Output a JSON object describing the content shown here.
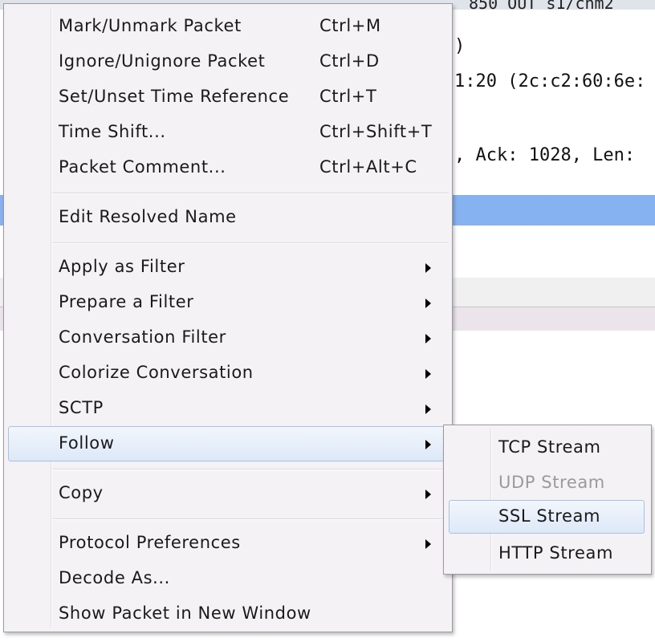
{
  "background": {
    "header_text": "850 OUT s1/chm2",
    "detail_lines": [
      ")",
      "1:20 (2c:c2:60:6e:",
      ", Ack: 1028, Len:"
    ]
  },
  "context_menu": {
    "items": [
      {
        "label": "Mark/Unmark Packet",
        "shortcut": "Ctrl+M"
      },
      {
        "label": "Ignore/Unignore Packet",
        "shortcut": "Ctrl+D"
      },
      {
        "label": "Set/Unset Time Reference",
        "shortcut": "Ctrl+T"
      },
      {
        "label": "Time Shift...",
        "shortcut": "Ctrl+Shift+T"
      },
      {
        "label": "Packet Comment...",
        "shortcut": "Ctrl+Alt+C"
      },
      {
        "label": "Edit Resolved Name"
      },
      {
        "label": "Apply as Filter"
      },
      {
        "label": "Prepare a Filter"
      },
      {
        "label": "Conversation Filter"
      },
      {
        "label": "Colorize Conversation"
      },
      {
        "label": "SCTP"
      },
      {
        "label": "Follow"
      },
      {
        "label": "Copy"
      },
      {
        "label": "Protocol Preferences"
      },
      {
        "label": "Decode As..."
      },
      {
        "label": "Show Packet in New Window"
      }
    ]
  },
  "follow_submenu": {
    "items": [
      {
        "label": "TCP Stream"
      },
      {
        "label": "UDP Stream"
      },
      {
        "label": "SSL Stream"
      },
      {
        "label": "HTTP Stream"
      }
    ]
  }
}
